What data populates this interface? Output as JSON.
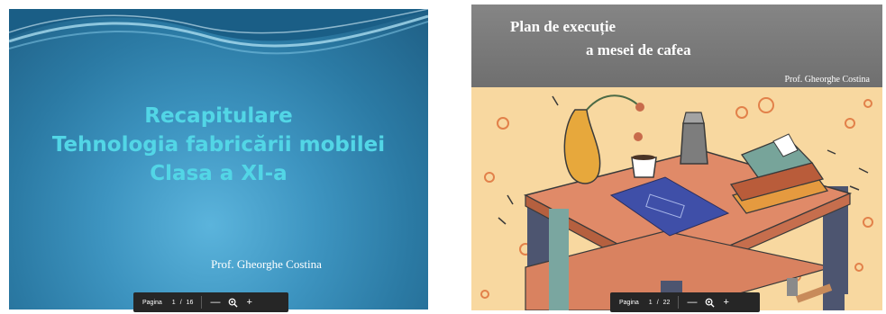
{
  "slides": [
    {
      "title_lines": [
        "Recapitulare",
        "Tehnologia fabricării mobilei",
        "Clasa a XI-a"
      ],
      "author": "Prof. Gheorghe Costina",
      "toolbar": {
        "page_label": "Pagina",
        "current_page": "1",
        "separator": "/",
        "total_pages": "16",
        "zoom_out": "—",
        "zoom_icon": "zoom-icon",
        "zoom_in": "+"
      }
    },
    {
      "title_line1": "Plan de execuție",
      "title_line2": "a mesei de cafea",
      "author": "Prof. Gheorghe Costina",
      "toolbar": {
        "page_label": "Pagina",
        "current_page": "1",
        "separator": "/",
        "total_pages": "22",
        "zoom_out": "—",
        "zoom_icon": "zoom-icon",
        "zoom_in": "+"
      }
    }
  ],
  "colors": {
    "slide1_title": "#52d6e6",
    "slide1_bg": "#3d94c0",
    "slide2_header": "#7a7a7a",
    "slide2_bg": "#f8d8a0",
    "toolbar": "#262626"
  }
}
